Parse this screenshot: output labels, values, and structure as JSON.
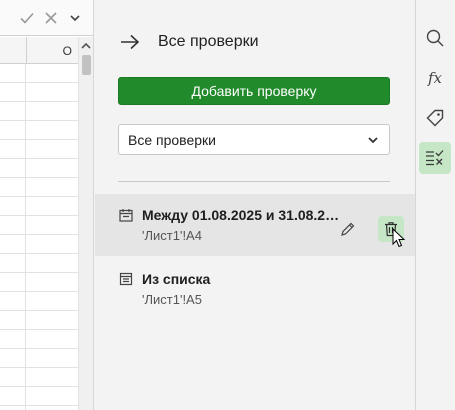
{
  "sheet": {
    "column_label": "O"
  },
  "panel": {
    "title": "Все проверки",
    "add_button_label": "Добавить проверку",
    "filter": {
      "selected": "Все проверки"
    },
    "rules": [
      {
        "title": "Между 01.08.2025 и 31.08.2…",
        "range": "'Лист1'!A4",
        "icon": "calendar-icon"
      },
      {
        "title": "Из списка",
        "range": "'Лист1'!A5",
        "icon": "list-icon"
      }
    ]
  },
  "right_toolbar": {
    "items": [
      "search-icon",
      "function-icon",
      "tag-icon",
      "data-validation-icon"
    ],
    "fx_label": "fx"
  },
  "colors": {
    "accent": "#218a2a",
    "active_bg": "#c6e7c6",
    "selected_row": "#e5e5e5"
  }
}
